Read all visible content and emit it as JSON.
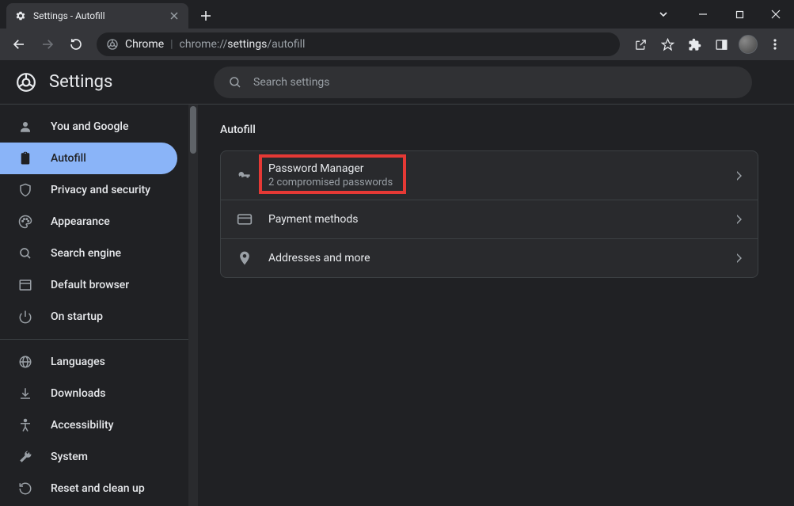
{
  "window": {
    "tab_title": "Settings - Autofill"
  },
  "omnibox": {
    "label": "Chrome",
    "url_prefix": "chrome://",
    "url_bold": "settings",
    "url_suffix": "/autofill"
  },
  "header": {
    "title": "Settings",
    "search_placeholder": "Search settings"
  },
  "sidebar": {
    "items": [
      {
        "label": "You and Google"
      },
      {
        "label": "Autofill"
      },
      {
        "label": "Privacy and security"
      },
      {
        "label": "Appearance"
      },
      {
        "label": "Search engine"
      },
      {
        "label": "Default browser"
      },
      {
        "label": "On startup"
      }
    ],
    "items2": [
      {
        "label": "Languages"
      },
      {
        "label": "Downloads"
      },
      {
        "label": "Accessibility"
      },
      {
        "label": "System"
      },
      {
        "label": "Reset and clean up"
      }
    ]
  },
  "main": {
    "section_title": "Autofill",
    "rows": [
      {
        "title": "Password Manager",
        "subtitle": "2 compromised passwords"
      },
      {
        "title": "Payment methods",
        "subtitle": ""
      },
      {
        "title": "Addresses and more",
        "subtitle": ""
      }
    ]
  }
}
